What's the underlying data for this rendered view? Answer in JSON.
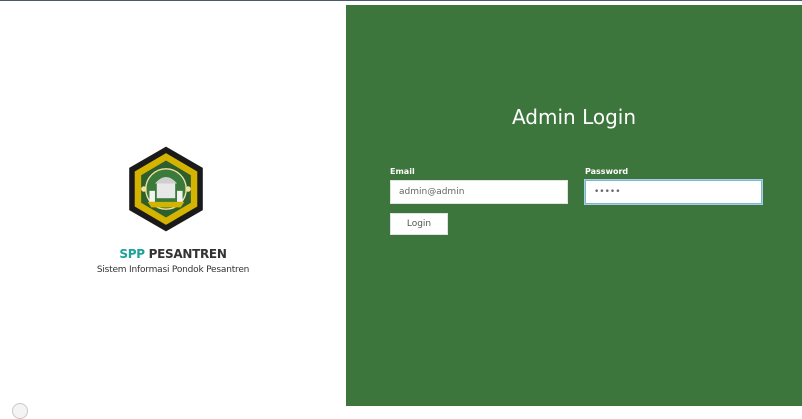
{
  "brand": {
    "accent": "SPP",
    "name": " PESANTREN",
    "subtitle": "Sistem Informasi Pondok Pesantren"
  },
  "login": {
    "title": "Admin Login",
    "email_label": "Email",
    "email_value": "admin@admin",
    "password_label": "Password",
    "password_value": "•••••",
    "button_label": "Login"
  },
  "colors": {
    "panel_green": "#3c763d",
    "accent_teal": "#1aa39a",
    "logo_gold": "#d4b400"
  },
  "icons": {
    "logo": "pesantren-emblem-icon"
  }
}
